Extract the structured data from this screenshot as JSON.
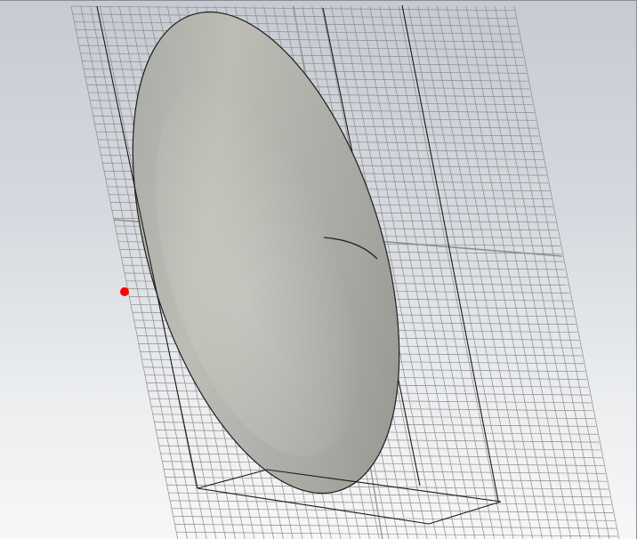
{
  "viewport": {
    "background_top_color": "#c6cbd3",
    "background_bottom_color": "#f7f7f8",
    "grid_color": "#8c8c8c",
    "wire_color": "#1a1a1a",
    "dish_color": "#b0b0aa",
    "marker_color": "#ff0000",
    "icons": [
      "grid-plane-icon",
      "bounding-box-icon",
      "reflector-dish-icon",
      "feed-line-icon",
      "probe-point-icon"
    ]
  }
}
